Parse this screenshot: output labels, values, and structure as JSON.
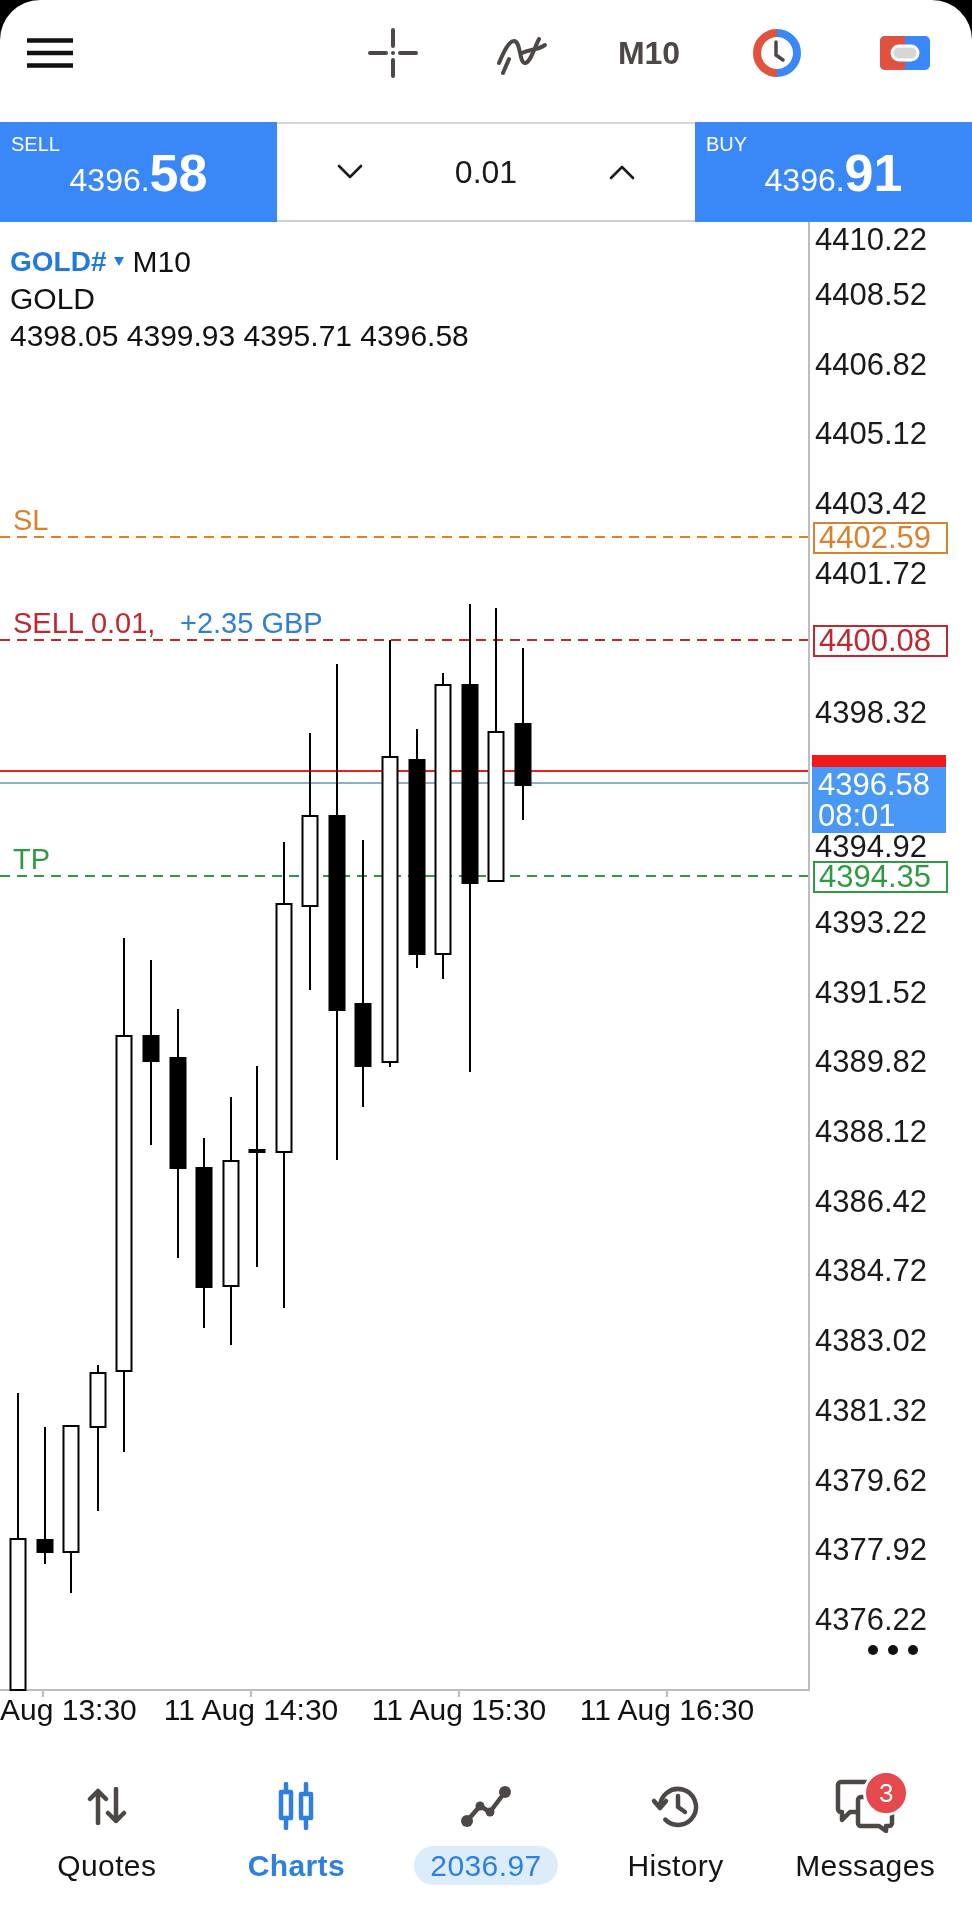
{
  "top_bar": {
    "timeframe": "M10"
  },
  "trade_panel": {
    "sell": {
      "label": "SELL",
      "price": "4396.",
      "pips": "58"
    },
    "volume": "0.01",
    "buy": {
      "label": "BUY",
      "price": "4396.",
      "pips": "91"
    }
  },
  "chart": {
    "symbol": "GOLD#",
    "timeframe": "M10",
    "description": "GOLD",
    "ohlc": "4398.05 4399.93 4395.71 4396.58",
    "levels": [
      {
        "kind": "stop_loss",
        "label": "SL",
        "price": "4402.59",
        "color": "#d7822e"
      },
      {
        "kind": "order",
        "label": "SELL 0.01,",
        "profit": "+2.35 GBP",
        "price": "4400.08",
        "color": "#c0282e"
      },
      {
        "kind": "take_profit",
        "label": "TP",
        "price": "4394.35",
        "color": "#2f9a42"
      }
    ],
    "bid": {
      "price": "4396.58",
      "countdown": "08:01"
    },
    "price_axis": [
      "4410.22",
      "4408.52",
      "4406.82",
      "4405.12",
      "4403.42",
      "4401.72",
      "4398.32",
      "4394.92",
      "4393.22",
      "4391.52",
      "4389.82",
      "4388.12",
      "4386.42",
      "4384.72",
      "4383.02",
      "4381.32",
      "4379.62",
      "4377.92",
      "4376.22"
    ],
    "time_axis": [
      "Aug 13:30",
      "11 Aug 14:30",
      "11 Aug 15:30",
      "11 Aug 16:30"
    ]
  },
  "bottom_nav": [
    {
      "kind": "quotes",
      "label": "Quotes",
      "selected": false
    },
    {
      "kind": "charts",
      "label": "Charts",
      "selected": true
    },
    {
      "kind": "trade",
      "label": "2036.97",
      "selected": false
    },
    {
      "kind": "history",
      "label": "History",
      "selected": false
    },
    {
      "kind": "messages",
      "label": "Messages",
      "selected": false,
      "badge": "3"
    }
  ]
}
